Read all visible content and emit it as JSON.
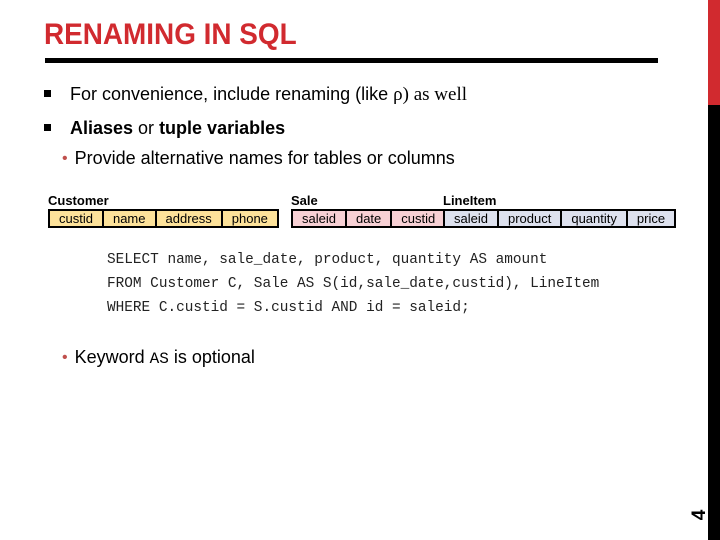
{
  "slide": {
    "title": "RENAMING IN SQL",
    "page_number": "4",
    "colors": {
      "accent": "#d12a2f",
      "customer_fill": "#fde29a",
      "sale_fill": "#f7d0d4",
      "lineitem_fill": "#dde1ee",
      "sub_bullet": "#c0504d"
    }
  },
  "bullets": [
    {
      "text_sans": "For convenience, include renaming (like ",
      "text_serif": "ρ) as well"
    },
    {
      "bold1": "Aliases",
      "mid": " or ",
      "bold2": "tuple variables"
    }
  ],
  "sub_bullets": [
    {
      "text": "Provide alternative names for tables or columns"
    },
    {
      "pre": "Keyword ",
      "code": "AS",
      "post": " is optional"
    }
  ],
  "tables": [
    {
      "name": "Customer",
      "columns": [
        "custid",
        "name",
        "address",
        "phone"
      ]
    },
    {
      "name": "Sale",
      "columns": [
        "saleid",
        "date",
        "custid"
      ]
    },
    {
      "name": "LineItem",
      "columns": [
        "saleid",
        "product",
        "quantity",
        "price"
      ]
    }
  ],
  "sql": [
    "SELECT name, sale_date, product, quantity AS amount",
    "FROM Customer C, Sale AS S(id,sale_date,custid), LineItem",
    "WHERE C.custid = S.custid AND id = saleid;"
  ]
}
